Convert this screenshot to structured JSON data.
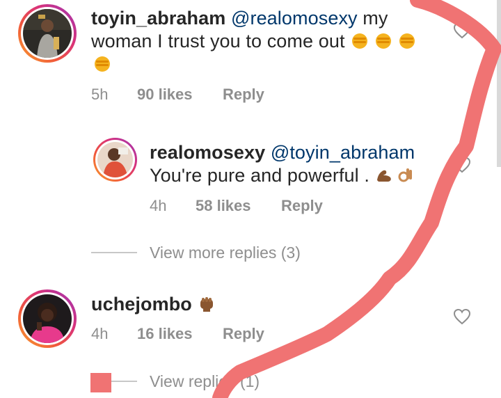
{
  "comments": [
    {
      "username": "toyin_abraham",
      "mention": "@realomosexy",
      "text": " my woman I trust you to come out",
      "emojis": [
        "oncoming-fist-emoji",
        "oncoming-fist-emoji",
        "oncoming-fist-emoji",
        "oncoming-fist-emoji"
      ],
      "time": "5h",
      "likes": "90 likes",
      "reply_label": "Reply"
    },
    {
      "username": "uchejombo",
      "text": "",
      "emojis": [
        "raised-fist-emoji"
      ],
      "time": "4h",
      "likes": "16 likes",
      "reply_label": "Reply",
      "view_replies": "View replies (1)"
    }
  ],
  "reply": {
    "username": "realomosexy",
    "mention": "@toyin_abraham",
    "text": "You're pure and powerful .",
    "emojis": [
      "flexed-biceps-emoji",
      "ok-hand-emoji"
    ],
    "time": "4h",
    "likes": "58 likes",
    "reply_label": "Reply"
  },
  "view_more_replies": "View more replies (3)",
  "colors": {
    "username": "#262626",
    "mention": "#00376b",
    "meta": "#8e8e8e",
    "annotation": "#f07373"
  }
}
